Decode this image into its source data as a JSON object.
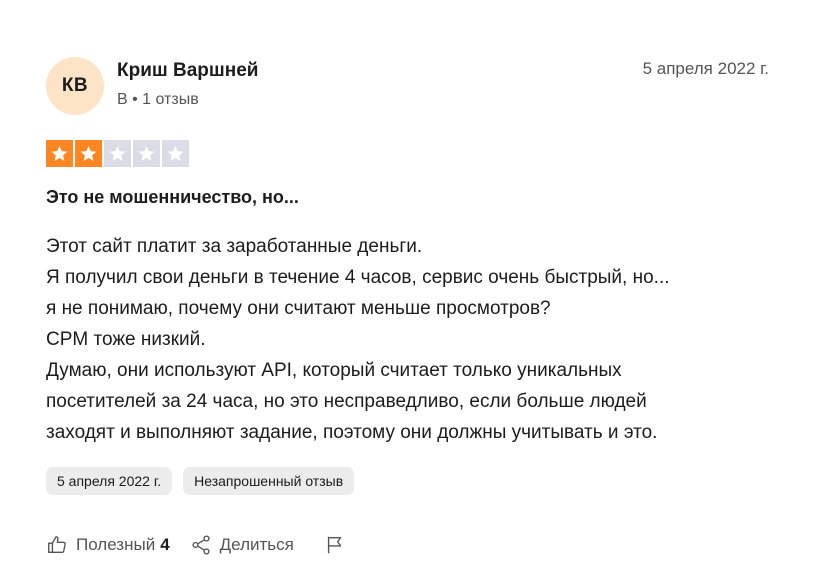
{
  "author": {
    "initials": "КВ",
    "name": "Криш Варшней",
    "meta": "B • 1 отзыв"
  },
  "review": {
    "date": "5 апреля 2022 г.",
    "rating": 2,
    "rating_max": 5,
    "title": "Это не мошенничество, но...",
    "body_lines": [
      "Этот сайт платит за заработанные деньги.",
      "Я получил свои деньги в течение 4 часов, сервис очень быстрый, но...",
      "я не понимаю, почему они считают меньше просмотров?",
      "CPM тоже низкий.",
      "Думаю, они используют API, который считает только уникальных",
      "посетителей за 24 часа, но это несправедливо, если больше людей",
      "заходят и выполняют задание, поэтому они должны учитывать и это."
    ]
  },
  "tags": {
    "date_tag": "5 апреля 2022 г.",
    "type_tag": "Незапрошенный отзыв"
  },
  "actions": {
    "useful_label": "Полезный",
    "useful_count": "4",
    "share_label": "Делиться"
  },
  "colors": {
    "star_on": "#ff8622",
    "star_off": "#dcdce6",
    "avatar_bg": "#fde4c6"
  },
  "icons": [
    "star-icon",
    "thumbs-up-icon",
    "share-icon",
    "flag-icon"
  ]
}
